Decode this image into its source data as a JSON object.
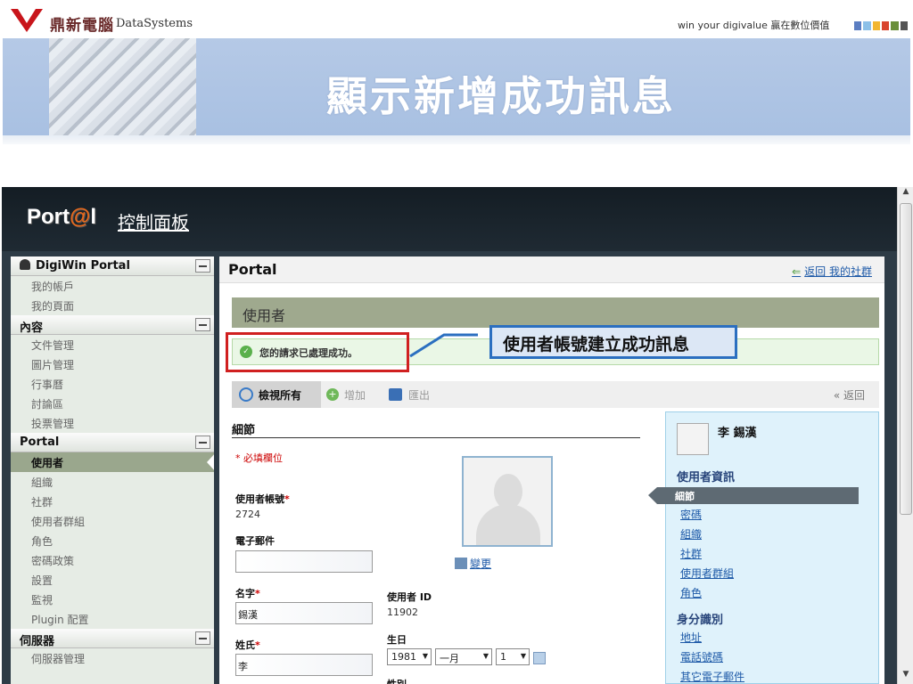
{
  "slide": {
    "logo_cn": "鼎新電腦",
    "logo_en": "DataSystems",
    "slogan": "win your digivalue 贏在數位價值",
    "title": "顯示新增成功訊息",
    "dot_colors": [
      "#5b7ec2",
      "#8cc0e8",
      "#f2b631",
      "#d9442d",
      "#6a8f3a",
      "#555555"
    ]
  },
  "portal": {
    "logo_text": "Port",
    "logo_at": "@",
    "logo_tail": "l",
    "panel_title": "控制面板"
  },
  "sidebar": {
    "sections": [
      {
        "title": "DigiWin Portal",
        "items": [
          "我的帳戶",
          "我的頁面"
        ]
      },
      {
        "title": "內容",
        "items": [
          "文件管理",
          "圖片管理",
          "行事曆",
          "討論區",
          "投票管理"
        ]
      },
      {
        "title": "Portal",
        "items": [
          "使用者",
          "組織",
          "社群",
          "使用者群組",
          "角色",
          "密碼政策",
          "設置",
          "監視",
          "Plugin 配置"
        ]
      },
      {
        "title": "伺服器",
        "items": [
          "伺服器管理"
        ]
      }
    ],
    "active_item": "使用者"
  },
  "content": {
    "title": "Portal",
    "back_link": "返回 我的社群",
    "section_title": "使用者",
    "success_message": "您的請求已處理成功。",
    "toolbar": {
      "view_all": "檢視所有",
      "add": "增加",
      "export": "匯出",
      "back": "« 返回"
    },
    "details_title": "細節",
    "required_note": "* 必填欄位",
    "fields": {
      "screen_name_label": "使用者帳號",
      "screen_name_value": "2724",
      "email_label": "電子郵件",
      "email_value": "",
      "first_name_label": "名字",
      "first_name_value": "錫漢",
      "last_name_label": "姓氏",
      "last_name_value": "李",
      "user_id_label": "使用者 ID",
      "user_id_value": "11902",
      "birthday_label": "生日",
      "birth_year": "1981",
      "birth_month": "一月",
      "birth_day": "1",
      "gender_label": "性別"
    },
    "change_link": "變更"
  },
  "right_panel": {
    "name": "李 錫漢",
    "user_info_title": "使用者資訊",
    "active_item": "細節",
    "user_info_links": [
      "密碼",
      "組織",
      "社群",
      "使用者群組",
      "角色"
    ],
    "identity_title": "身分識別",
    "identity_links": [
      "地址",
      "電話號碼",
      "其它電子郵件"
    ]
  },
  "annotation": {
    "callout": "使用者帳號建立成功訊息"
  }
}
